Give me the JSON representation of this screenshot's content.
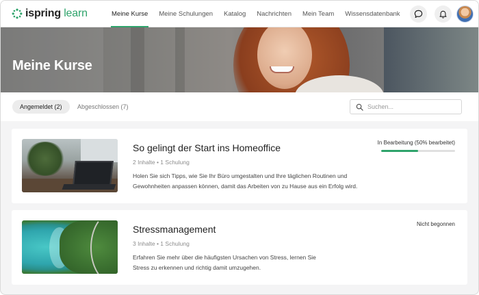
{
  "brand": {
    "name_part1": "ispring",
    "name_part2": "learn",
    "color": "#2ea36b"
  },
  "nav": {
    "items": [
      {
        "label": "Meine Kurse",
        "active": true
      },
      {
        "label": "Meine Schulungen",
        "active": false
      },
      {
        "label": "Katalog",
        "active": false
      },
      {
        "label": "Nachrichten",
        "active": false
      },
      {
        "label": "Mein Team",
        "active": false
      },
      {
        "label": "Wissensdatenbank",
        "active": false
      }
    ]
  },
  "header_icons": [
    "chat-bubble-icon",
    "bell-icon",
    "user-avatar"
  ],
  "hero": {
    "title": "Meine Kurse"
  },
  "filters": {
    "tabs": [
      {
        "label": "Angemeldet (2)",
        "active": true
      },
      {
        "label": "Abgeschlossen (7)",
        "active": false
      }
    ],
    "search_placeholder": "Suchen..."
  },
  "courses": [
    {
      "title": "So gelingt der Start ins Homeoffice",
      "meta": "2 Inhalte  •  1 Schulung",
      "description": "Holen Sie sich Tipps, wie Sie Ihr Büro umgestalten und Ihre täglichen Routinen und Gewohnheiten anpassen können, damit das Arbeiten von zu Hause aus ein Erfolg wird.",
      "status": "In Bearbeitung (50% bearbeitet)",
      "progress_percent": 50
    },
    {
      "title": "Stressmanagement",
      "meta": "3 Inhalte  •  1 Schulung",
      "description": "Erfahren Sie mehr über die häufigsten Ursachen von Stress, lernen Sie Stress zu erkennen und richtig damit umzugehen.",
      "status": "Nicht begonnen",
      "progress_percent": null
    }
  ]
}
